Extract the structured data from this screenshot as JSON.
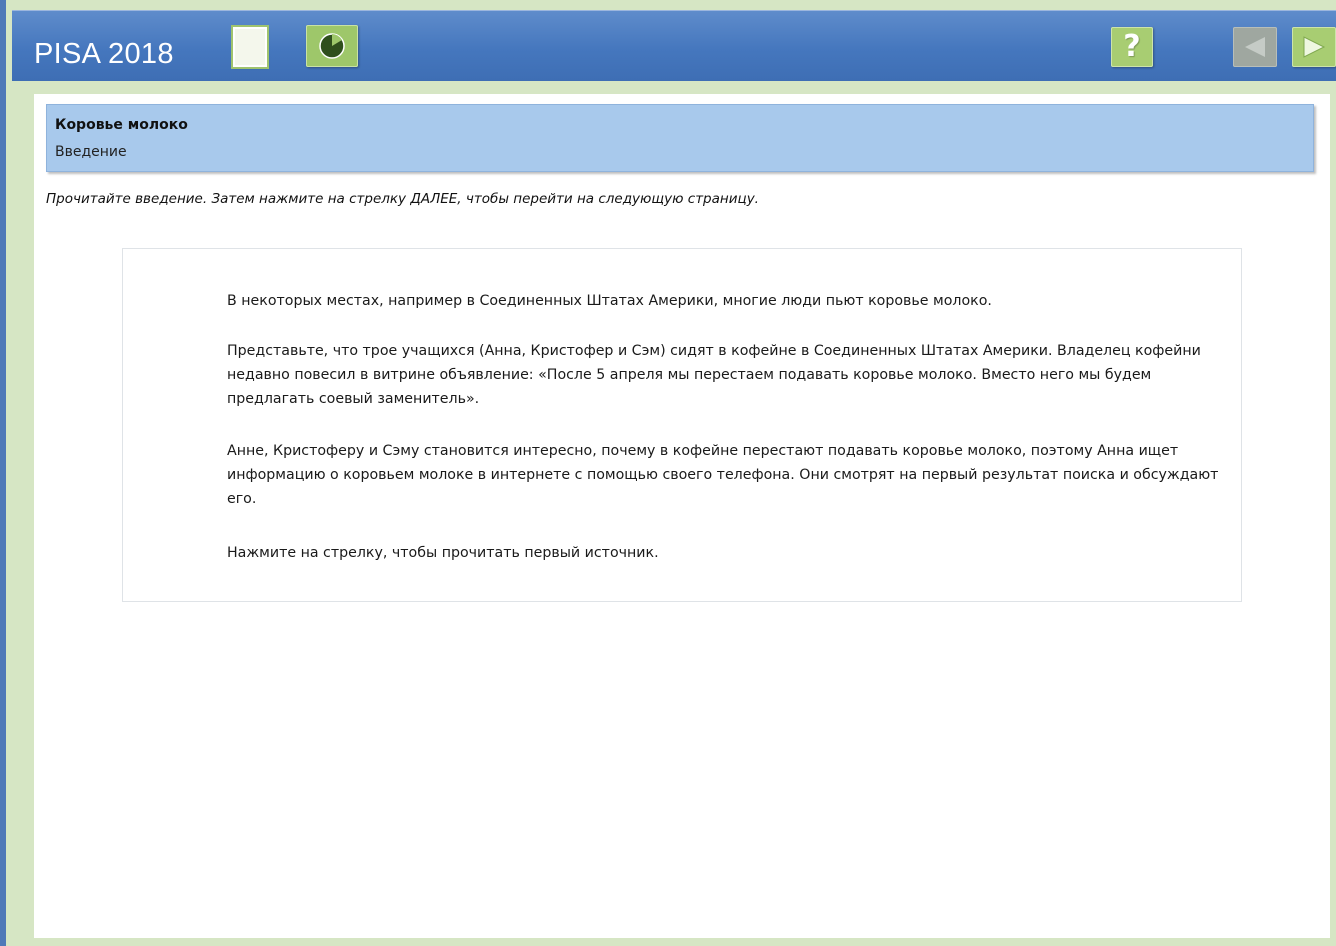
{
  "app": {
    "title": "PISA 2018"
  },
  "toolbar": {
    "icons": [
      "document-icon",
      "timer-icon",
      "help-icon",
      "previous-arrow-icon",
      "next-arrow-icon"
    ],
    "help_label": "?",
    "prev_enabled": false,
    "next_enabled": true
  },
  "unit": {
    "title": "Коровье молоко",
    "subtitle": "Введение"
  },
  "instruction": "Прочитайте введение. Затем нажмите на стрелку ДАЛЕЕ, чтобы перейти на следующую страницу.",
  "passage": {
    "paragraphs": [
      "В некоторых местах, например в Соединенных Штатах Америки, многие люди пьют коровье молоко.",
      "Представьте, что трое учащихся (Анна, Кристофер и Сэм) сидят в кофейне в Соединенных Штатах Америки. Владелец кофейни недавно повесил в витрине объявление: «После 5 апреля мы перестаем подавать коровье молоко. Вместо него мы будем предлагать соевый заменитель».",
      "Анне, Кристоферу и Сэму становится интересно, почему в кофейне перестают подавать коровье молоко, поэтому Анна ищет информацию о коровьем молоке в интернете с помощью своего телефона. Они смотрят на первый результат поиска и обсуждают его.",
      "Нажмите на стрелку, чтобы прочитать первый источник."
    ]
  },
  "colors": {
    "header": "#4577be",
    "frame": "#d6e6c4",
    "unit_bar": "#a8c9ec",
    "button_green": "#a8cd72",
    "button_disabled": "#9fa7a0"
  }
}
